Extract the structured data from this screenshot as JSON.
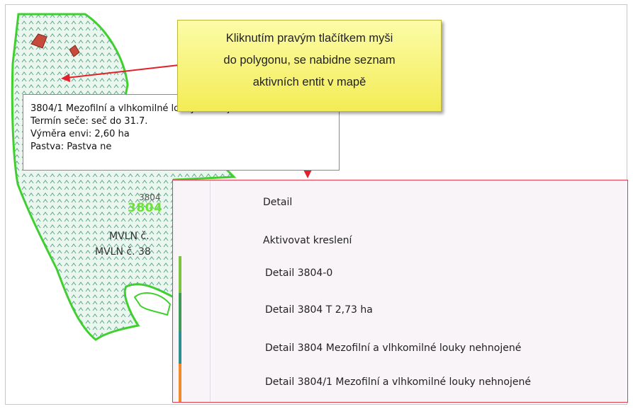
{
  "callout": {
    "lines": [
      "Kliknutím pravým tlačítkem myši",
      "do polygonu, se nabidne seznam",
      "aktivních entit v mapě"
    ]
  },
  "tooltip": {
    "lines": [
      "3804/1 Mezofilní a vlhkomilné louky nehnojené",
      "Termín seče: seč do 31.7.",
      "Výměra envi: 2,60 ha",
      "Pastva: Pastva ne"
    ]
  },
  "map": {
    "parcel_label": "3804",
    "parcel_small_label": "3804",
    "mvln_lines": [
      "MVLN č.",
      "MVLN č. 38"
    ],
    "colors": {
      "polygon_outline": "#3fd12b",
      "polygon_hatch": "#5aa88b",
      "polygon_fill": "#e8f6ec",
      "arrow": "#e3202b"
    }
  },
  "context_menu": {
    "items": [
      {
        "label": "Detail"
      },
      {
        "label": "Aktivovat kreslení"
      },
      {
        "label": "Detail 3804-0",
        "indicator_color": "#7cc43f"
      },
      {
        "label": "Detail 3804 T 2,73 ha",
        "indicator_color": "#3f9a58"
      },
      {
        "label": "Detail 3804 Mezofilní a vlhkomilné louky nehnojené",
        "indicator_color": "#2f8f90"
      },
      {
        "label": "Detail 3804/1 Mezofilní a vlhkomilné louky nehnojené",
        "indicator_color": "#f08a2a"
      }
    ],
    "border_color": "#e23b4e"
  }
}
